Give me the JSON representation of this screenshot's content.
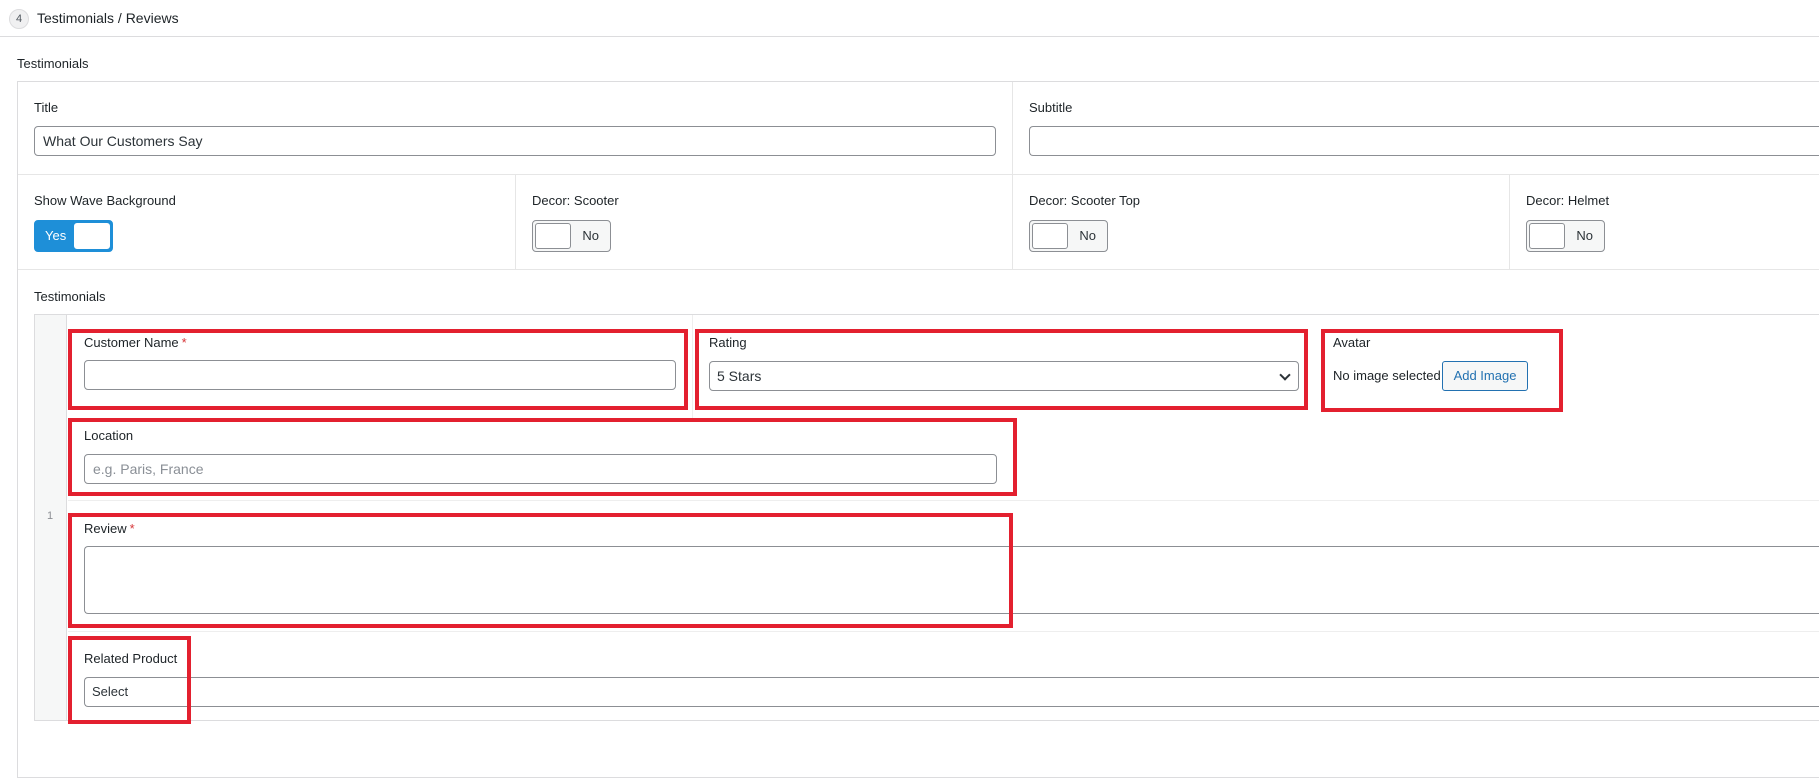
{
  "section": {
    "number": "4",
    "title": "Testimonials / Reviews"
  },
  "group": {
    "label": "Testimonials"
  },
  "fields": {
    "title_label": "Title",
    "title_value": "What Our Customers Say",
    "subtitle_label": "Subtitle",
    "subtitle_value": ""
  },
  "toggles": [
    {
      "label": "Show Wave Background",
      "state": "Yes",
      "on": true
    },
    {
      "label": "Decor: Scooter",
      "state": "No",
      "on": false
    },
    {
      "label": "Decor: Scooter Top",
      "state": "No",
      "on": false
    },
    {
      "label": "Decor: Helmet",
      "state": "No",
      "on": false
    }
  ],
  "repeater": {
    "label": "Testimonials",
    "row_index": "1",
    "customer_name_label": "Customer Name",
    "required_mark": "*",
    "customer_name_value": "",
    "rating_label": "Rating",
    "rating_value": "5 Stars",
    "avatar_label": "Avatar",
    "avatar_status": "No image selected",
    "add_image_label": "Add Image",
    "location_label": "Location",
    "location_placeholder": "e.g. Paris, France",
    "review_label": "Review",
    "related_product_label": "Related Product",
    "related_product_value": "Select"
  },
  "colors": {
    "toggle_on": "#1e8fd8",
    "link_blue": "#2271b1",
    "highlight_red": "#e3202f",
    "required_red": "#d63638"
  }
}
